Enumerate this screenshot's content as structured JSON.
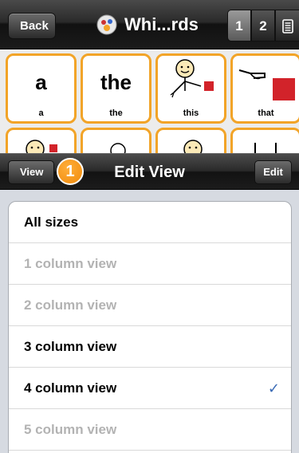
{
  "topbar": {
    "back_label": "Back",
    "title": "Whi...rds",
    "segments": [
      "1",
      "2"
    ],
    "segment_icon": "keyboard-icon"
  },
  "grid": {
    "cells": [
      {
        "big": "a",
        "caption": "a"
      },
      {
        "big": "the",
        "caption": "the"
      },
      {
        "big": "",
        "caption": "this",
        "icon": "person-pointing-square-icon"
      },
      {
        "big": "",
        "caption": "that",
        "icon": "hand-pointing-square-icon"
      }
    ]
  },
  "edit_view": {
    "back_label": "View",
    "badge": "1",
    "title": "Edit View",
    "edit_label": "Edit"
  },
  "list": {
    "items": [
      {
        "label": "All sizes",
        "enabled": true,
        "checked": false
      },
      {
        "label": "1 column view",
        "enabled": false,
        "checked": false
      },
      {
        "label": "2 column view",
        "enabled": false,
        "checked": false
      },
      {
        "label": "3 column view",
        "enabled": true,
        "checked": false
      },
      {
        "label": "4 column view",
        "enabled": true,
        "checked": true
      },
      {
        "label": "5 column view",
        "enabled": false,
        "checked": false
      }
    ],
    "check_glyph": "✓"
  },
  "colors": {
    "accent_orange": "#f2a428",
    "check_blue": "#3a6ab5",
    "disabled_text": "#b3b3b3"
  }
}
